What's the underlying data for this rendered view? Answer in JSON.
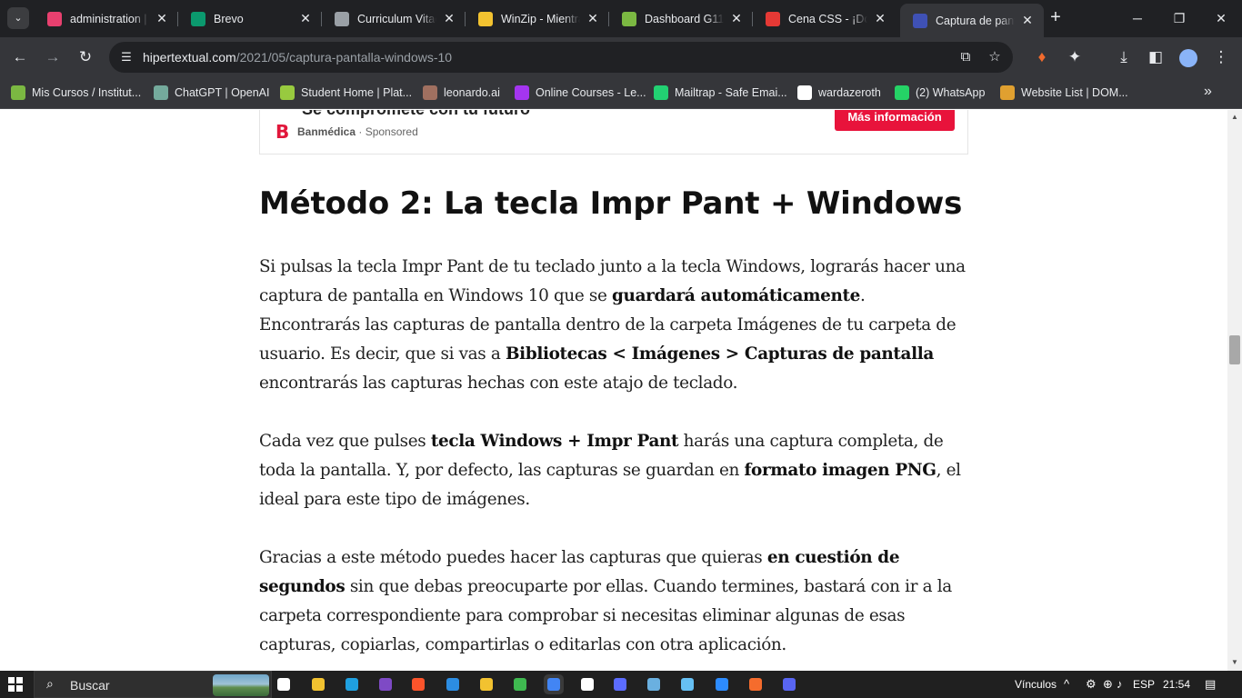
{
  "tabs": [
    {
      "title": "administration | a",
      "favicon": "analytics-icon",
      "color": "#e8406f"
    },
    {
      "title": "Brevo",
      "favicon": "brevo-icon",
      "color": "#0b996e"
    },
    {
      "title": "Curriculum Vitae",
      "favicon": "globe-icon",
      "color": "#9aa0a6"
    },
    {
      "title": "WinZip - Mientras",
      "favicon": "winzip-icon",
      "color": "#f2c230"
    },
    {
      "title": "Dashboard G11",
      "favicon": "dashboard-icon",
      "color": "#7bb842"
    },
    {
      "title": "Cena CSS - ¡Done",
      "favicon": "record-icon",
      "color": "#e53935"
    },
    {
      "title": "Captura de pantalla",
      "favicon": "hipertextual-icon",
      "color": "#3f51b5",
      "active": true
    }
  ],
  "address": {
    "host": "hipertextual.com",
    "path": "/2021/05/captura-pantalla-windows-10"
  },
  "bookmarks": [
    {
      "label": "Mis Cursos / Institut...",
      "icon": "course-icon",
      "color": "#7bb842"
    },
    {
      "label": "ChatGPT | OpenAI",
      "icon": "openai-icon",
      "color": "#74aa9c"
    },
    {
      "label": "Student Home | Plat...",
      "icon": "platzi-icon",
      "color": "#98ca3f"
    },
    {
      "label": "leonardo.ai",
      "icon": "leonardo-icon",
      "color": "#a07060"
    },
    {
      "label": "Online Courses - Le...",
      "icon": "udemy-icon",
      "color": "#a435f0"
    },
    {
      "label": "Mailtrap - Safe Emai...",
      "icon": "mailtrap-icon",
      "color": "#22d172"
    },
    {
      "label": "wardazeroth",
      "icon": "github-icon",
      "color": "#ffffff"
    },
    {
      "label": "(2) WhatsApp",
      "icon": "whatsapp-icon",
      "color": "#25d366"
    },
    {
      "label": "Website List | DOM...",
      "icon": "dom-icon",
      "color": "#e0a030"
    }
  ],
  "ad": {
    "headline": "Sé compromete con tu futuro",
    "brand": "Banmédica",
    "sponsored": "Sponsored",
    "cta": "Más información"
  },
  "article": {
    "heading": "Método 2: La tecla Impr Pant + Windows",
    "p1": [
      {
        "t": "Si pulsas la tecla Impr Pant de tu teclado junto a la tecla Windows, lograrás hacer una captura de pantalla en Windows 10 que se ",
        "b": false
      },
      {
        "t": "guardará automáticamente",
        "b": true
      },
      {
        "t": ". Encontrarás las capturas de pantalla dentro de la carpeta Imágenes de tu carpeta de usuario. Es decir, que si vas a ",
        "b": false
      },
      {
        "t": "Bibliotecas < Imágenes > Capturas de pantalla",
        "b": true
      },
      {
        "t": " encontrarás las capturas hechas con este atajo de teclado.",
        "b": false
      }
    ],
    "p2": [
      {
        "t": "Cada vez que pulses ",
        "b": false
      },
      {
        "t": "tecla Windows + Impr Pant",
        "b": true
      },
      {
        "t": " harás una captura completa, de toda la pantalla. Y, por defecto, las capturas se guardan en ",
        "b": false
      },
      {
        "t": "formato imagen PNG",
        "b": true
      },
      {
        "t": ", el ideal para este tipo de imágenes.",
        "b": false
      }
    ],
    "p3": [
      {
        "t": "Gracias a este método puedes hacer las capturas que quieras ",
        "b": false
      },
      {
        "t": "en cuestión de segundos",
        "b": true
      },
      {
        "t": " sin que debas preocuparte por ellas. Cuando termines, bastará con ir a la carpeta correspondiente para comprobar si necesitas eliminar algunas de esas capturas, copiarlas, compartirlas o editarlas con otra aplicación.",
        "b": false
      }
    ]
  },
  "taskbar": {
    "search_placeholder": "Buscar",
    "apps": [
      {
        "icon": "task-view-icon",
        "color": "#ffffff"
      },
      {
        "icon": "file-explorer-icon",
        "color": "#f2c230"
      },
      {
        "icon": "edge-icon",
        "color": "#1fa0e0"
      },
      {
        "icon": "tor-browser-icon",
        "color": "#7e4ac5"
      },
      {
        "icon": "brave-icon",
        "color": "#fb542b"
      },
      {
        "icon": "vscode-icon",
        "color": "#2c8de3"
      },
      {
        "icon": "opera-gx-icon",
        "color": "#f2c230"
      },
      {
        "icon": "avast-browser-icon",
        "color": "#3fb950"
      },
      {
        "icon": "chrome-icon",
        "color": "#4285f4",
        "active": true
      },
      {
        "icon": "media-player-icon",
        "color": "#ffffff"
      },
      {
        "icon": "figma-plugin-icon",
        "color": "#5b6cff"
      },
      {
        "icon": "terminal-icon",
        "color": "#6ab0e0"
      },
      {
        "icon": "steam-icon",
        "color": "#66c0f4"
      },
      {
        "icon": "zoom-icon",
        "color": "#2d8cff"
      },
      {
        "icon": "origin-icon",
        "color": "#f56c2d"
      },
      {
        "icon": "discord-icon",
        "color": "#5865f2"
      }
    ],
    "tray_label": "Vínculos",
    "language": "ESP",
    "time": "21:54"
  }
}
